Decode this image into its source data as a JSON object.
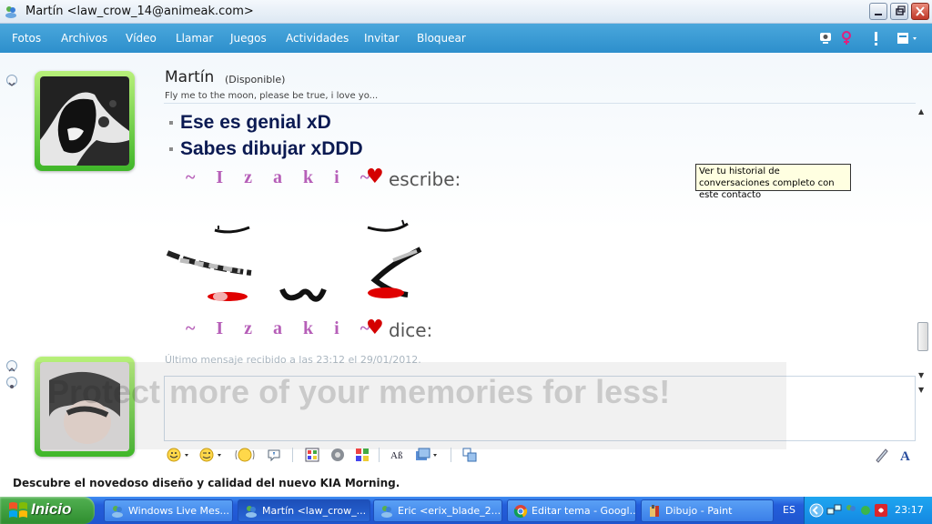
{
  "window": {
    "title": "Martín <law_crow_14@animeak.com>"
  },
  "menu": {
    "items": [
      "Fotos",
      "Archivos",
      "Vídeo",
      "Llamar",
      "Juegos",
      "Actividades",
      "Invitar",
      "Bloquear"
    ]
  },
  "contact": {
    "name": "Martín",
    "status": "(Disponible)",
    "personal_message": "Fly me to the moon, please be true, i love yo..."
  },
  "conversation": {
    "lines": [
      "Ese es genial xD",
      "Sabes dibujar xDDD"
    ],
    "sender": "~ I z a k i ~",
    "heart": "♥",
    "writes": "escribe:",
    "says": "dice:"
  },
  "tooltip": {
    "text": "Ver tu historial de conversaciones completo con este contacto"
  },
  "last_message": "Último mensaje recibido a las 23:12 el 29/01/2012.",
  "watermark": "Protect more of your memories for less!",
  "ad": "Descubre el novedoso diseño y calidad del nuevo KIA Morning.",
  "taskbar": {
    "start": "Inicio",
    "tasks": [
      "Windows Live Mes...",
      "Martín <law_crow_...",
      "Eric <erix_blade_2...",
      "Editar tema - Googl...",
      "Dibujo - Paint"
    ],
    "language": "ES",
    "clock": "23:17"
  },
  "colors": {
    "menu_bar": "#2d8fcc",
    "sender_purple": "#b65fb8",
    "heart_red": "#d40000",
    "message_navy": "#0b1a52"
  }
}
